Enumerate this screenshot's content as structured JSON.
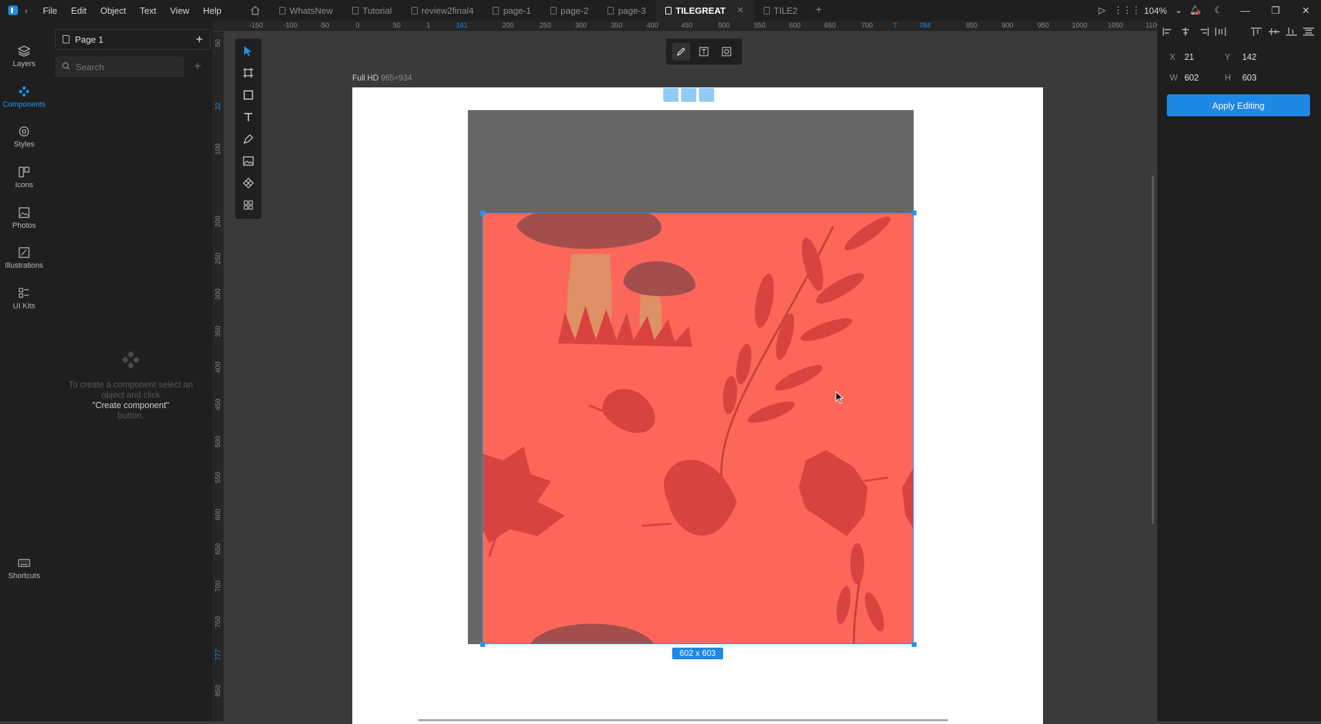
{
  "menu": [
    "File",
    "Edit",
    "Object",
    "Text",
    "View",
    "Help"
  ],
  "tabs": [
    {
      "label": "WhatsNew",
      "active": false
    },
    {
      "label": "Tutorial",
      "active": false
    },
    {
      "label": "review2final4",
      "active": false
    },
    {
      "label": "page-1",
      "active": false
    },
    {
      "label": "page-2",
      "active": false
    },
    {
      "label": "page-3",
      "active": false
    },
    {
      "label": "TILEGREAT",
      "active": true
    },
    {
      "label": "TILE2",
      "active": false
    }
  ],
  "topbar": {
    "zoom": "104%"
  },
  "leftnav": [
    {
      "label": "Layers",
      "icon": "layers-icon"
    },
    {
      "label": "Components",
      "icon": "components-icon",
      "active": true
    },
    {
      "label": "Styles",
      "icon": "styles-icon"
    },
    {
      "label": "Icons",
      "icon": "icons-icon"
    },
    {
      "label": "Photos",
      "icon": "photos-icon"
    },
    {
      "label": "Illustrations",
      "icon": "illustrations-icon"
    },
    {
      "label": "UI Kits",
      "icon": "ui-kits-icon"
    },
    {
      "label": "Shortcuts",
      "icon": "keyboard-icon"
    }
  ],
  "panel": {
    "page_name": "Page 1",
    "search_placeholder": "Search",
    "empty_line1": "To create a component select an",
    "empty_line2": "object and click",
    "empty_hl": "\"Create component\"",
    "empty_line3": "button."
  },
  "ruler_top": [
    {
      "t": "-150"
    },
    {
      "t": "-100"
    },
    {
      "t": "-50"
    },
    {
      "t": "0"
    },
    {
      "t": "50"
    },
    {
      "t": "1"
    },
    {
      "t": "161",
      "hl": true
    },
    {
      "t": "200"
    },
    {
      "t": "250"
    },
    {
      "t": "300"
    },
    {
      "t": "350"
    },
    {
      "t": "400"
    },
    {
      "t": "450"
    },
    {
      "t": "500"
    },
    {
      "t": "550"
    },
    {
      "t": "600"
    },
    {
      "t": "650"
    },
    {
      "t": "700"
    },
    {
      "t": "7",
      "hl": true
    },
    {
      "t": "784",
      "hl": true
    },
    {
      "t": "850"
    },
    {
      "t": "900"
    },
    {
      "t": "950"
    },
    {
      "t": "1000"
    },
    {
      "t": "1050"
    },
    {
      "t": "1100"
    }
  ],
  "ruler_left": [
    {
      "t": "50"
    },
    {
      "t": "32",
      "hl": true
    },
    {
      "t": "100"
    },
    {
      "t": "200"
    },
    {
      "t": "250"
    },
    {
      "t": "300"
    },
    {
      "t": "350"
    },
    {
      "t": "400"
    },
    {
      "t": "450"
    },
    {
      "t": "500"
    },
    {
      "t": "550"
    },
    {
      "t": "600"
    },
    {
      "t": "650"
    },
    {
      "t": "700"
    },
    {
      "t": "750"
    },
    {
      "t": "777",
      "hl": true
    },
    {
      "t": "850"
    }
  ],
  "frame": {
    "name": "Full HD",
    "dims": "965×934"
  },
  "selection": {
    "size_label": "602 x 603"
  },
  "props": {
    "x_label": "X",
    "x": "21",
    "y_label": "Y",
    "y": "142",
    "w_label": "W",
    "w": "602",
    "h_label": "H",
    "h": "603"
  },
  "apply_label": "Apply Editing",
  "colors": {
    "accent": "#1e88e5",
    "tile_bg": "#fd675a",
    "leaf": "#d8423f",
    "mushroom_cap": "#a14e4d",
    "stem": "#df9064"
  }
}
